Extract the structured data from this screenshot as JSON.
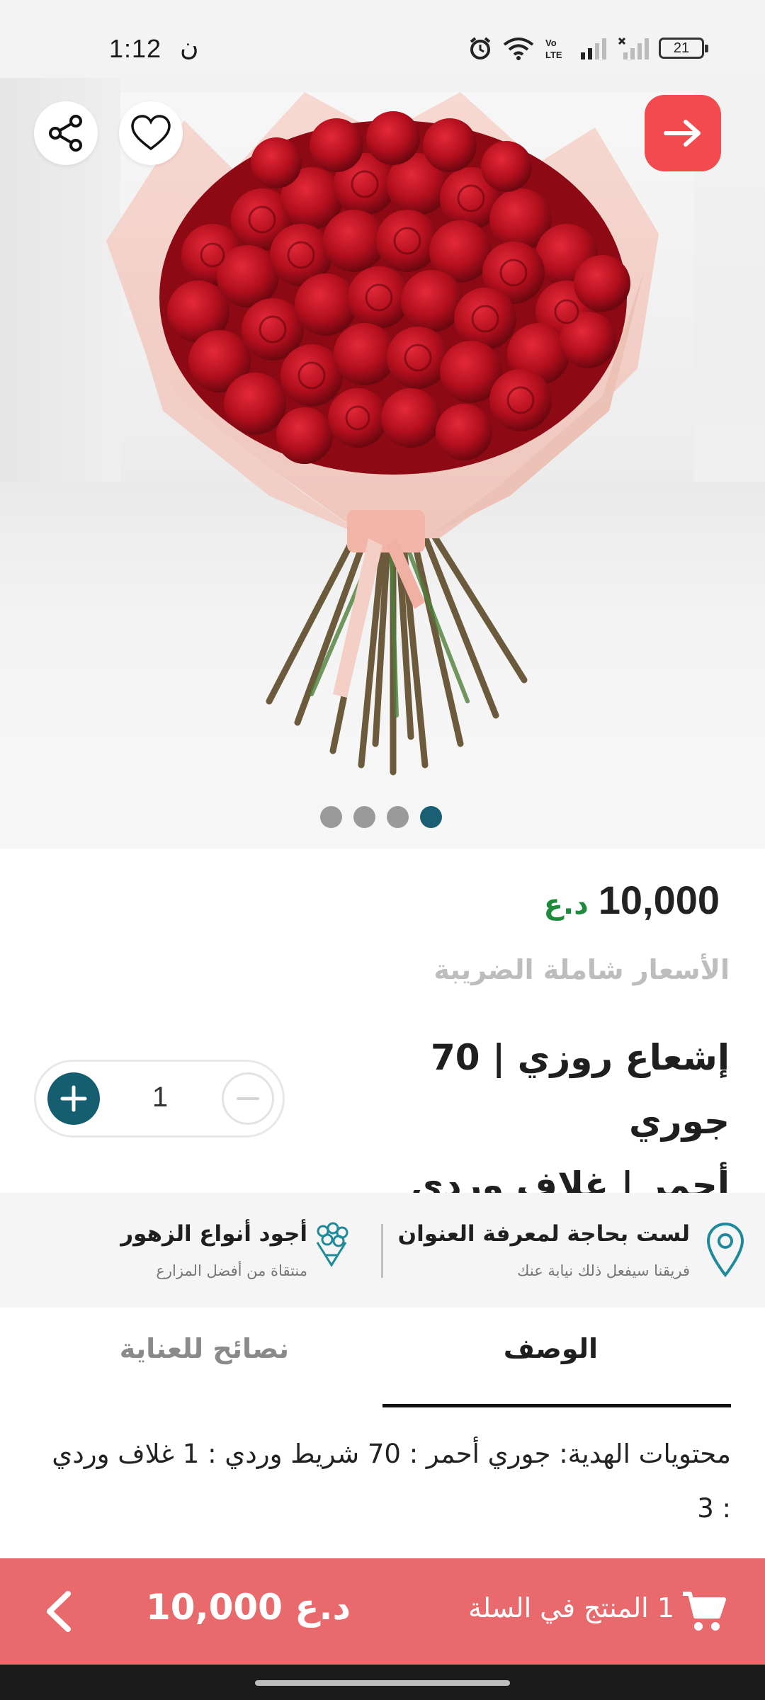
{
  "status_bar": {
    "time": "1:12",
    "carrier_glyph": "ن",
    "battery": "21",
    "icons": [
      "alarm-icon",
      "wifi-icon",
      "volte-icon",
      "signal-icon",
      "signal-no-sim-icon",
      "battery-icon"
    ]
  },
  "header": {
    "share_icon": "share-icon",
    "favorite_icon": "heart-icon",
    "back_icon": "arrow-right-icon",
    "accent_color": "#f24a4f"
  },
  "gallery": {
    "image_count": 4,
    "active_index": 3
  },
  "product": {
    "price": "10,000",
    "currency": "د.ع",
    "tax_note": "الأسعار شاملة الضريبة",
    "title_line1": "إشعاع روزي | 70 جوري",
    "title_line2": "أحمر | غلاف وردي",
    "quantity": "1"
  },
  "features": {
    "address_title": "لست بحاجة لمعرفة العنوان",
    "address_subtitle": "فريقنا سيفعل ذلك نيابة عنك",
    "flowers_title": "أجود أنواع الزهور",
    "flowers_subtitle": "منتقاة من أفضل المزارع"
  },
  "tabs": {
    "description": "الوصف",
    "care_tips": "نصائح للعناية"
  },
  "description_text": "محتويات الهدية: جوري أحمر : 70 شريط وردي : 1 غلاف وردي : 3",
  "cart_bar": {
    "label": "1 المنتج في السلة",
    "total": "10,000 د.ع",
    "background": "#e86a6c"
  }
}
